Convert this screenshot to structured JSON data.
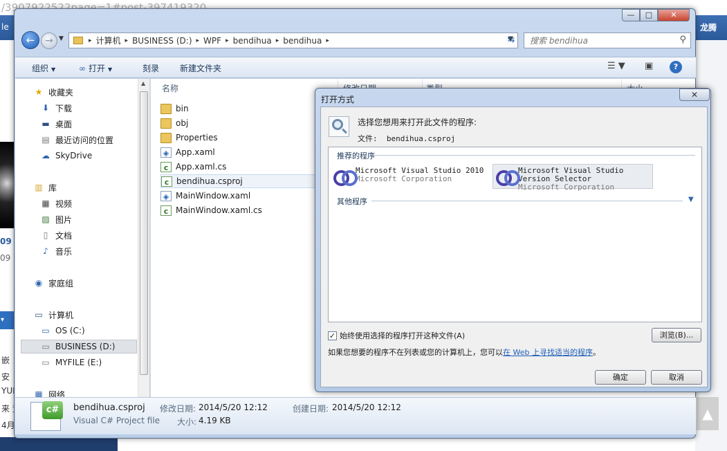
{
  "background": {
    "url_fragment": "/3907922522page=1#post-397419320",
    "left_text": "le",
    "right_text": "龙腾",
    "left_nums": [
      "09",
      "09"
    ],
    "left_cjk": [
      "嵌",
      "安",
      "YUI",
      "来 竞",
      "4月"
    ],
    "scroll_to_top": "▲"
  },
  "explorer": {
    "window_controls": {
      "minimize": "—",
      "maximize": "□",
      "close": "✕"
    },
    "breadcrumbs": [
      "计算机",
      "BUSINESS (D:)",
      "WPF",
      "bendihua",
      "bendihua"
    ],
    "search_placeholder": "搜索 bendihua",
    "toolbar": {
      "organize": "组织",
      "open": "打开",
      "burn": "刻录",
      "new_folder": "新建文件夹"
    },
    "nav": {
      "favorites": "收藏夹",
      "favorites_items": [
        "下载",
        "桌面",
        "最近访问的位置",
        "SkyDrive"
      ],
      "libraries": "库",
      "libraries_items": [
        "视频",
        "图片",
        "文档",
        "音乐"
      ],
      "homegroup": "家庭组",
      "computer": "计算机",
      "drives": [
        "OS (C:)",
        "BUSINESS (D:)",
        "MYFILE (E:)"
      ],
      "network": "网络"
    },
    "columns": {
      "name": "名称",
      "modified": "修改日期",
      "type": "类型",
      "size": "大小"
    },
    "files": [
      {
        "name": "bin",
        "kind": "folder"
      },
      {
        "name": "obj",
        "kind": "folder"
      },
      {
        "name": "Properties",
        "kind": "folder"
      },
      {
        "name": "App.xaml",
        "kind": "xaml"
      },
      {
        "name": "App.xaml.cs",
        "kind": "cs"
      },
      {
        "name": "bendihua.csproj",
        "kind": "csproj"
      },
      {
        "name": "MainWindow.xaml",
        "kind": "xaml"
      },
      {
        "name": "MainWindow.xaml.cs",
        "kind": "cs"
      }
    ],
    "details": {
      "filename": "bendihua.csproj",
      "filetype": "Visual C# Project file",
      "modified_label": "修改日期:",
      "modified_value": "2014/5/20 12:12",
      "created_label": "创建日期:",
      "created_value": "2014/5/20 12:12",
      "size_label": "大小:",
      "size_value": "4.19 KB"
    }
  },
  "dialog": {
    "title": "打开方式",
    "close": "✕",
    "prompt": "选择您想用来打开此文件的程序:",
    "file_label": "文件:",
    "file_name": "bendihua.csproj",
    "recommended": "推荐的程序",
    "programs": [
      {
        "name": "Microsoft Visual Studio 2010",
        "publisher": "Microsoft Corporation"
      },
      {
        "name": "Microsoft Visual Studio Version Selector",
        "publisher": "Microsoft Corporation"
      }
    ],
    "other": "其他程序",
    "always_use": "始终使用选择的程序打开这种文件(A)",
    "browse": "浏览(B)...",
    "hint_prefix": "如果您想要的程序不在列表或您的计算机上，您可以",
    "hint_link": "在 Web 上寻找适当的程序",
    "hint_suffix": "。",
    "ok": "确定",
    "cancel": "取消"
  }
}
